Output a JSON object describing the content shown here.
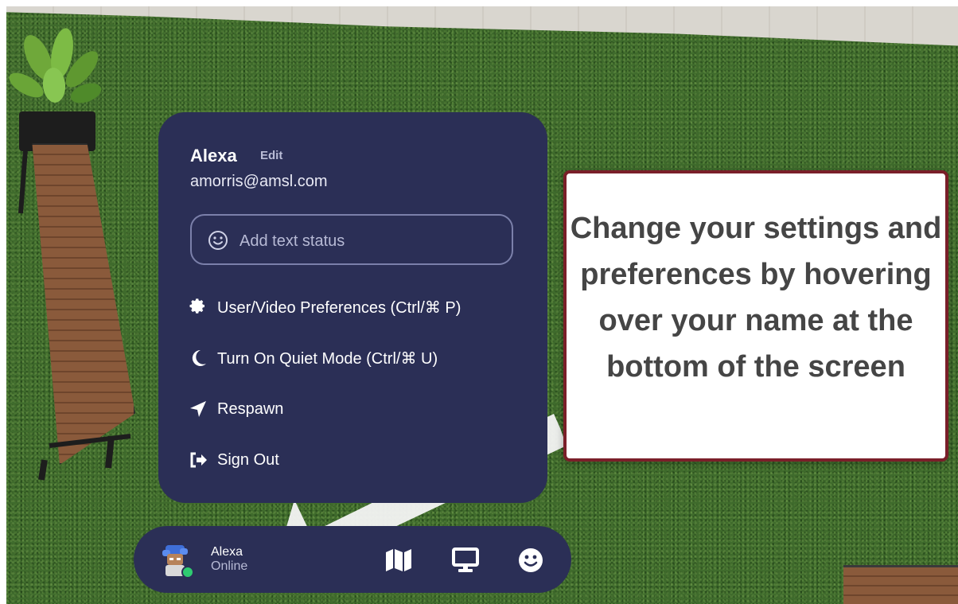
{
  "menu": {
    "name": "Alexa",
    "edit_label": "Edit",
    "email": "amorris@amsl.com",
    "status_placeholder": "Add text status",
    "items": [
      {
        "label": "User/Video Preferences (Ctrl/⌘ P)",
        "icon": "gear-icon"
      },
      {
        "label": "Turn On Quiet Mode (Ctrl/⌘ U)",
        "icon": "moon-icon"
      },
      {
        "label": "Respawn",
        "icon": "location-arrow-icon"
      },
      {
        "label": "Sign Out",
        "icon": "sign-out-icon"
      }
    ]
  },
  "callout": {
    "text": "Change your settings and preferences by hovering over your name at the bottom of the screen"
  },
  "bottom_bar": {
    "name": "Alexa",
    "status": "Online",
    "buttons": [
      "map-icon",
      "screen-share-icon",
      "emoji-icon"
    ]
  },
  "colors": {
    "panel": "#2b2f56",
    "callout_border": "#7a1f29",
    "online": "#2ecc71",
    "grass": "#3f6b2c"
  }
}
